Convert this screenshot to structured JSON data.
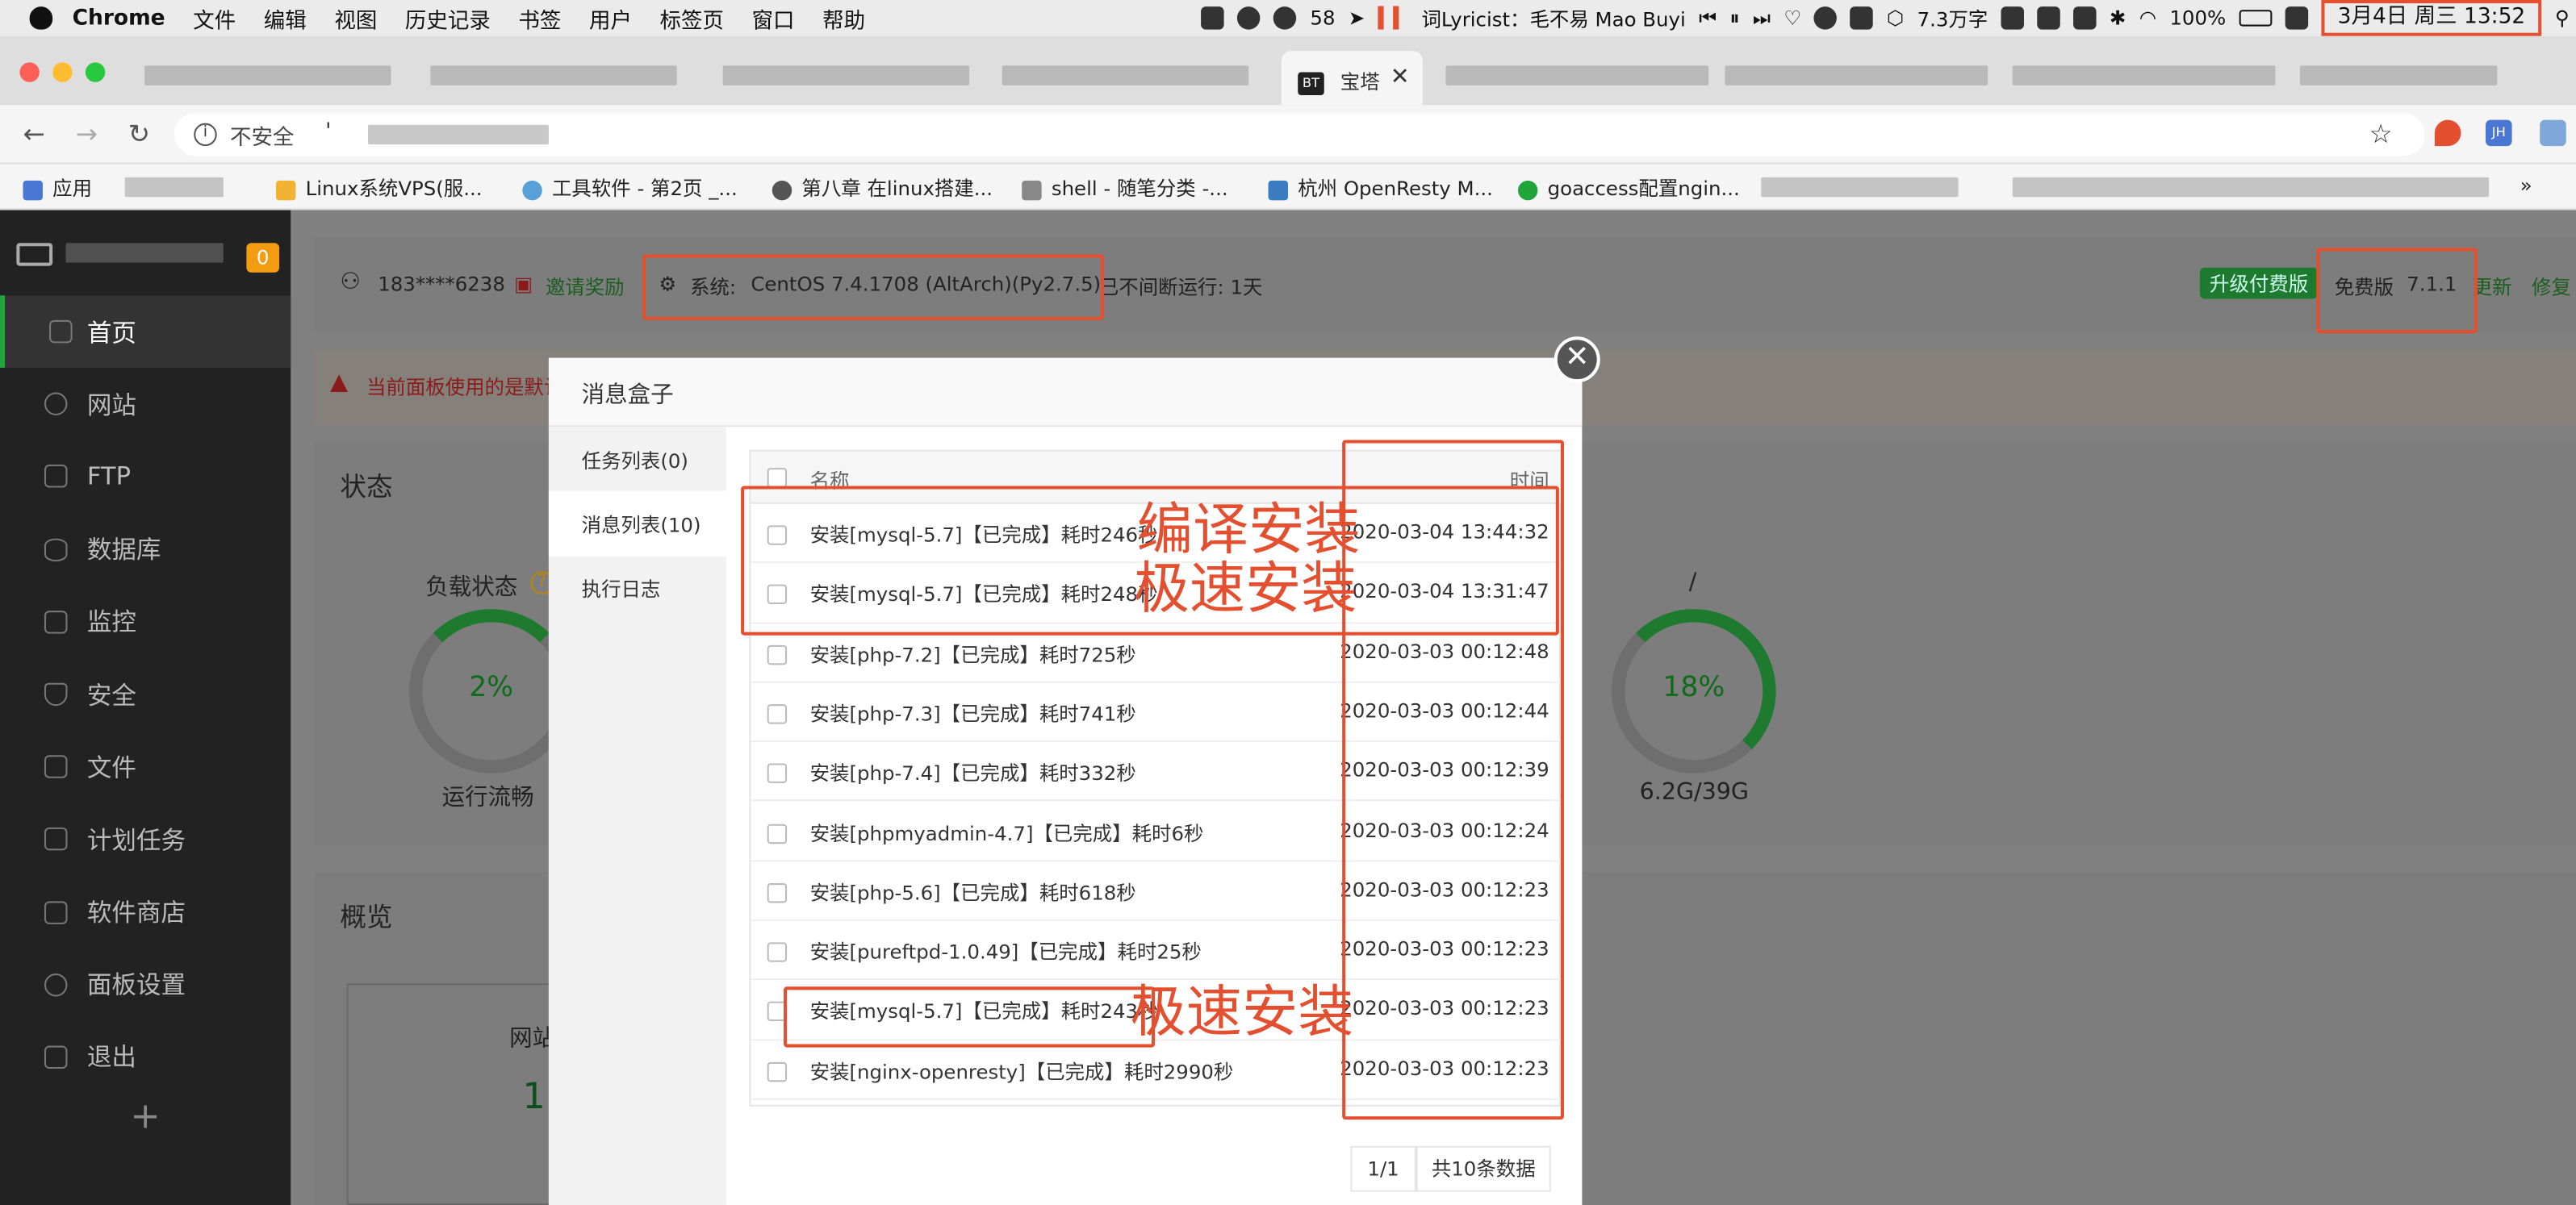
{
  "menubar": {
    "app": "Chrome",
    "items": [
      "文件",
      "编辑",
      "视图",
      "历史记录",
      "书签",
      "用户",
      "标签页",
      "窗口",
      "帮助"
    ],
    "wechat_count": "58",
    "lyric": "词Lyricist：毛不易 Mao Buyi",
    "wordcount": "7.3万字",
    "battery": "100%",
    "clock": "3月4日 周三  13:52"
  },
  "tabs": {
    "active_label": "宝塔",
    "active_icon": "BT",
    "close": "✕"
  },
  "address": {
    "insecure": "不安全",
    "url": "'"
  },
  "toolbar_ext": {
    "jh": "JH"
  },
  "bookmarks": [
    {
      "label": "应用"
    },
    {
      "label": "Linux系统VPS(服..."
    },
    {
      "label": "工具软件 - 第2页 _..."
    },
    {
      "label": "第八章 在linux搭建..."
    },
    {
      "label": "shell - 随笔分类 -..."
    },
    {
      "label": "杭州 OpenResty M..."
    },
    {
      "label": "goaccess配置ngin..."
    }
  ],
  "bookmarks_more": "»",
  "sidebar": {
    "badge": "0",
    "items": [
      {
        "label": "首页",
        "icon": "home-icon"
      },
      {
        "label": "网站",
        "icon": "globe-icon"
      },
      {
        "label": "FTP",
        "icon": "ftp-icon"
      },
      {
        "label": "数据库",
        "icon": "database-icon"
      },
      {
        "label": "监控",
        "icon": "monitor-icon"
      },
      {
        "label": "安全",
        "icon": "shield-icon"
      },
      {
        "label": "文件",
        "icon": "folder-icon"
      },
      {
        "label": "计划任务",
        "icon": "calendar-icon"
      },
      {
        "label": "软件商店",
        "icon": "grid-icon"
      },
      {
        "label": "面板设置",
        "icon": "gear-icon"
      },
      {
        "label": "退出",
        "icon": "logout-icon"
      }
    ],
    "add": "+"
  },
  "topbar": {
    "user": "183****6238",
    "invite": "邀请奖励",
    "system_label": "系统:",
    "system_value": "CentOS 7.4.1708 (AltArch)(Py2.7.5)",
    "uptime": "已不间断运行: 1天",
    "upgrade": "升级付费版",
    "edition": "免费版",
    "version": "7.1.1",
    "update": "更新",
    "repair": "修复"
  },
  "alert": {
    "text": "当前面板使用的是默认"
  },
  "status": {
    "title": "状态",
    "load_label": "负载状态",
    "load_value": "2%",
    "load_caption": "运行流畅",
    "disk_label": "/",
    "disk_value": "18%",
    "disk_caption": "6.2G/39G"
  },
  "overview": {
    "title": "概览",
    "site_label": "网站",
    "site_count": "1"
  },
  "modal": {
    "title": "消息盒子",
    "close": "✕",
    "side": [
      {
        "label": "任务列表(0)"
      },
      {
        "label": "消息列表(10)"
      },
      {
        "label": "执行日志"
      }
    ],
    "columns": {
      "name": "名称",
      "time": "时间"
    },
    "rows": [
      {
        "name": "安装[mysql-5.7]【已完成】耗时246秒",
        "time": "2020-03-04 13:44:32"
      },
      {
        "name": "安装[mysql-5.7]【已完成】耗时248秒",
        "time": "2020-03-04 13:31:47"
      },
      {
        "name": "安装[php-7.2]【已完成】耗时725秒",
        "time": "2020-03-03 00:12:48"
      },
      {
        "name": "安装[php-7.3]【已完成】耗时741秒",
        "time": "2020-03-03 00:12:44"
      },
      {
        "name": "安装[php-7.4]【已完成】耗时332秒",
        "time": "2020-03-03 00:12:39"
      },
      {
        "name": "安装[phpmyadmin-4.7]【已完成】耗时6秒",
        "time": "2020-03-03 00:12:24"
      },
      {
        "name": "安装[php-5.6]【已完成】耗时618秒",
        "time": "2020-03-03 00:12:23"
      },
      {
        "name": "安装[pureftpd-1.0.49]【已完成】耗时25秒",
        "time": "2020-03-03 00:12:23"
      },
      {
        "name": "安装[mysql-5.7]【已完成】耗时243秒",
        "time": "2020-03-03 00:12:23"
      },
      {
        "name": "安装[nginx-openresty]【已完成】耗时2990秒",
        "time": "2020-03-03 00:12:23"
      }
    ],
    "pager_page": "1/1",
    "pager_total": "共10条数据"
  },
  "annotations": {
    "compile": "编译安装",
    "fast1": "极速安装",
    "fast2": "极速安装"
  },
  "colors": {
    "annotation": "#e4502f",
    "accent": "#20a53a"
  }
}
